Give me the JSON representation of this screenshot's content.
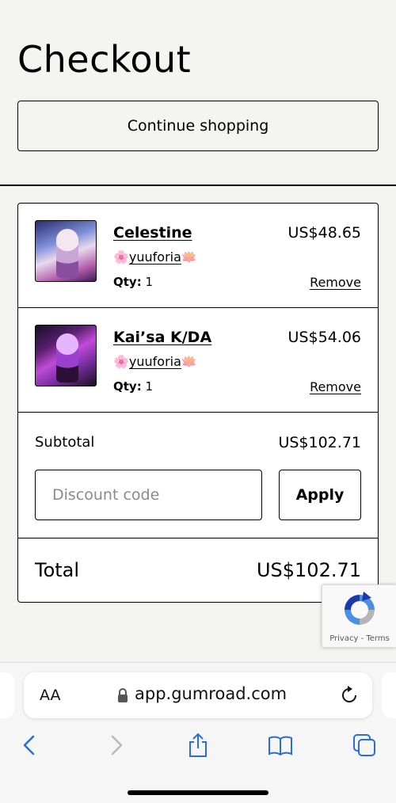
{
  "page": {
    "title": "Checkout",
    "continue_label": "Continue shopping"
  },
  "cart": {
    "items": [
      {
        "name": "Celestine",
        "creator": "yuuforia",
        "creator_prefix_emoji": "🌸",
        "creator_suffix_emoji": "🪷",
        "qty_label": "Qty:",
        "qty": "1",
        "price": "US$48.65",
        "remove_label": "Remove"
      },
      {
        "name": "Kai’sa K/DA",
        "creator": "yuuforia",
        "creator_prefix_emoji": "🌸",
        "creator_suffix_emoji": "🪷",
        "qty_label": "Qty:",
        "qty": "1",
        "price": "US$54.06",
        "remove_label": "Remove"
      }
    ],
    "subtotal_label": "Subtotal",
    "subtotal_value": "US$102.71",
    "discount_placeholder": "Discount code",
    "apply_label": "Apply",
    "total_label": "Total",
    "total_value": "US$102.71"
  },
  "recaptcha": {
    "terms": "Privacy - Terms"
  },
  "browser": {
    "aa_label": "AA",
    "url": "app.gumroad.com"
  }
}
